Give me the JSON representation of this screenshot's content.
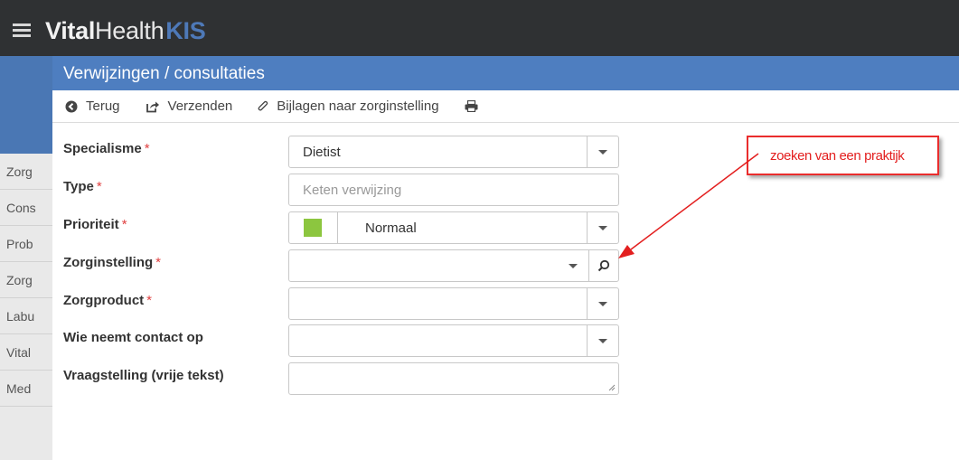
{
  "app": {
    "brand_part1": "Vital",
    "brand_part2": "Health",
    "brand_part3": "KIS"
  },
  "sidebar": {
    "items": [
      {
        "label": "Zorg"
      },
      {
        "label": "Cons"
      },
      {
        "label": "Prob"
      },
      {
        "label": "Zorg"
      },
      {
        "label": "Labu"
      },
      {
        "label": "Vital"
      },
      {
        "label": "Med"
      }
    ]
  },
  "dialog": {
    "title": "Verwijzingen / consultaties",
    "toolbar": {
      "back_label": "Terug",
      "send_label": "Verzenden",
      "attachments_label": "Bijlagen naar zorginstelling"
    },
    "form": {
      "specialisme": {
        "label": "Specialisme",
        "required": "*",
        "value": "Dietist"
      },
      "type": {
        "label": "Type",
        "required": "*",
        "placeholder": "Keten verwijzing"
      },
      "prioriteit": {
        "label": "Prioriteit",
        "required": "*",
        "value": "Normaal",
        "color": "#8cc63f"
      },
      "zorginstelling": {
        "label": "Zorginstelling",
        "required": "*",
        "value": ""
      },
      "zorgproduct": {
        "label": "Zorgproduct",
        "required": "*",
        "value": ""
      },
      "contact": {
        "label": "Wie neemt contact op",
        "value": ""
      },
      "vraagstelling": {
        "label": "Vraagstelling (vrije tekst)",
        "value": ""
      }
    }
  },
  "annotation": {
    "text": "zoeken van een praktijk",
    "color": "#e31f1f"
  },
  "colors": {
    "topbar": "#2f3133",
    "dialog_header": "#4e7ec0",
    "brand_accent": "#4e79b8",
    "required": "#e04040"
  }
}
